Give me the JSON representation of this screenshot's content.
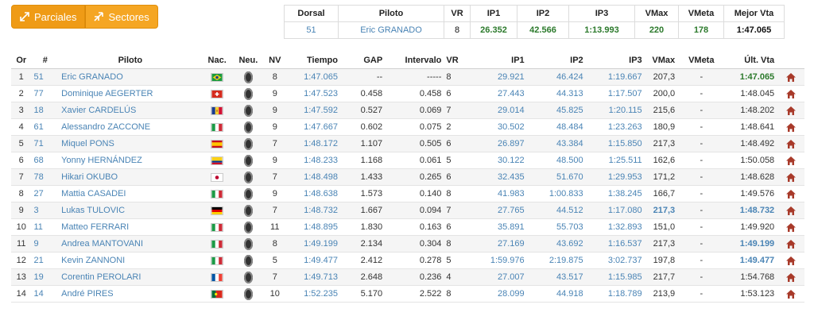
{
  "tabs": [
    {
      "label": "Parciales",
      "icon": "expand-arrows-icon"
    },
    {
      "label": "Sectores",
      "icon": "shrink-arrows-icon"
    }
  ],
  "best": {
    "headers": [
      "Dorsal",
      "Piloto",
      "VR",
      "IP1",
      "IP2",
      "IP3",
      "VMax",
      "VMeta",
      "Mejor Vta"
    ],
    "row": {
      "dorsal": "51",
      "piloto": "Eric GRANADO",
      "vr": "8",
      "ip1": "26.352",
      "ip2": "42.566",
      "ip3": "1:13.993",
      "vmax": "220",
      "vmeta": "178",
      "mejor": "1:47.065"
    }
  },
  "main": {
    "headers": [
      "Or",
      "#",
      "Piloto",
      "Nac.",
      "Neu.",
      "NV",
      "Tiempo",
      "GAP",
      "Intervalo",
      "VR",
      "IP1",
      "IP2",
      "IP3",
      "VMax",
      "VMeta",
      "Últ. Vta"
    ],
    "rows": [
      {
        "or": "1",
        "num": "51",
        "piloto": "Eric GRANADO",
        "flag": "brazil",
        "nv": "8",
        "tiempo": "1:47.065",
        "gap": "--",
        "intervalo": "-----",
        "vr": "8",
        "ip1": "29.921",
        "ip2": "46.424",
        "ip3": "1:19.667",
        "vmax": "207,3",
        "vmeta": "-",
        "ult": "1:47.065",
        "ult_hl": true
      },
      {
        "or": "2",
        "num": "77",
        "piloto": "Dominique AEGERTER",
        "flag": "switzerland",
        "nv": "9",
        "tiempo": "1:47.523",
        "gap": "0.458",
        "intervalo": "0.458",
        "vr": "6",
        "ip1": "27.443",
        "ip2": "44.313",
        "ip3": "1:17.507",
        "vmax": "200,0",
        "vmeta": "-",
        "ult": "1:48.045",
        "ult_hl": false
      },
      {
        "or": "3",
        "num": "18",
        "piloto": "Xavier CARDELÚS",
        "flag": "andorra",
        "nv": "9",
        "tiempo": "1:47.592",
        "gap": "0.527",
        "intervalo": "0.069",
        "vr": "7",
        "ip1": "29.014",
        "ip2": "45.825",
        "ip3": "1:20.115",
        "vmax": "215,6",
        "vmeta": "-",
        "ult": "1:48.202",
        "ult_hl": false
      },
      {
        "or": "4",
        "num": "61",
        "piloto": "Alessandro ZACCONE",
        "flag": "italy",
        "nv": "9",
        "tiempo": "1:47.667",
        "gap": "0.602",
        "intervalo": "0.075",
        "vr": "2",
        "ip1": "30.502",
        "ip2": "48.484",
        "ip3": "1:23.263",
        "vmax": "180,9",
        "vmeta": "-",
        "ult": "1:48.641",
        "ult_hl": false
      },
      {
        "or": "5",
        "num": "71",
        "piloto": "Miquel PONS",
        "flag": "spain",
        "nv": "7",
        "tiempo": "1:48.172",
        "gap": "1.107",
        "intervalo": "0.505",
        "vr": "6",
        "ip1": "26.897",
        "ip2": "43.384",
        "ip3": "1:15.850",
        "vmax": "217,3",
        "vmeta": "-",
        "ult": "1:48.492",
        "ult_hl": false
      },
      {
        "or": "6",
        "num": "68",
        "piloto": "Yonny HERNÁNDEZ",
        "flag": "colombia",
        "nv": "9",
        "tiempo": "1:48.233",
        "gap": "1.168",
        "intervalo": "0.061",
        "vr": "5",
        "ip1": "30.122",
        "ip2": "48.500",
        "ip3": "1:25.511",
        "vmax": "162,6",
        "vmeta": "-",
        "ult": "1:50.058",
        "ult_hl": false
      },
      {
        "or": "7",
        "num": "78",
        "piloto": "Hikari OKUBO",
        "flag": "japan",
        "nv": "7",
        "tiempo": "1:48.498",
        "gap": "1.433",
        "intervalo": "0.265",
        "vr": "6",
        "ip1": "32.435",
        "ip2": "51.670",
        "ip3": "1:29.953",
        "vmax": "171,2",
        "vmeta": "-",
        "ult": "1:48.628",
        "ult_hl": false
      },
      {
        "or": "8",
        "num": "27",
        "piloto": "Mattia CASADEI",
        "flag": "italy",
        "nv": "9",
        "tiempo": "1:48.638",
        "gap": "1.573",
        "intervalo": "0.140",
        "vr": "8",
        "ip1": "41.983",
        "ip2": "1:00.833",
        "ip3": "1:38.245",
        "vmax": "166,7",
        "vmeta": "-",
        "ult": "1:49.576",
        "ult_hl": false
      },
      {
        "or": "9",
        "num": "3",
        "piloto": "Lukas TULOVIC",
        "flag": "germany",
        "nv": "7",
        "tiempo": "1:48.732",
        "gap": "1.667",
        "intervalo": "0.094",
        "vr": "7",
        "ip1": "27.765",
        "ip2": "44.512",
        "ip3": "1:17.080",
        "vmax": "217,3",
        "vmeta": "-",
        "ult": "1:48.732",
        "ult_hl": true,
        "vmax_hl": true
      },
      {
        "or": "10",
        "num": "11",
        "piloto": "Matteo FERRARI",
        "flag": "italy",
        "nv": "11",
        "tiempo": "1:48.895",
        "gap": "1.830",
        "intervalo": "0.163",
        "vr": "6",
        "ip1": "35.891",
        "ip2": "55.703",
        "ip3": "1:32.893",
        "vmax": "151,0",
        "vmeta": "-",
        "ult": "1:49.920",
        "ult_hl": false
      },
      {
        "or": "11",
        "num": "9",
        "piloto": "Andrea MANTOVANI",
        "flag": "italy",
        "nv": "8",
        "tiempo": "1:49.199",
        "gap": "2.134",
        "intervalo": "0.304",
        "vr": "8",
        "ip1": "27.169",
        "ip2": "43.692",
        "ip3": "1:16.537",
        "vmax": "217,3",
        "vmeta": "-",
        "ult": "1:49.199",
        "ult_hl": true
      },
      {
        "or": "12",
        "num": "21",
        "piloto": "Kevin ZANNONI",
        "flag": "italy",
        "nv": "5",
        "tiempo": "1:49.477",
        "gap": "2.412",
        "intervalo": "0.278",
        "vr": "5",
        "ip1": "1:59.976",
        "ip2": "2:19.875",
        "ip3": "3:02.737",
        "vmax": "197,8",
        "vmeta": "-",
        "ult": "1:49.477",
        "ult_hl": true
      },
      {
        "or": "13",
        "num": "19",
        "piloto": "Corentin PEROLARI",
        "flag": "france",
        "nv": "7",
        "tiempo": "1:49.713",
        "gap": "2.648",
        "intervalo": "0.236",
        "vr": "4",
        "ip1": "27.007",
        "ip2": "43.517",
        "ip3": "1:15.985",
        "vmax": "217,7",
        "vmeta": "-",
        "ult": "1:54.768",
        "ult_hl": false
      },
      {
        "or": "14",
        "num": "14",
        "piloto": "André PIRES",
        "flag": "portugal",
        "nv": "10",
        "tiempo": "1:52.235",
        "gap": "5.170",
        "intervalo": "2.522",
        "vr": "8",
        "ip1": "28.099",
        "ip2": "44.918",
        "ip3": "1:18.789",
        "vmax": "213,9",
        "vmeta": "-",
        "ult": "1:53.123",
        "ult_hl": false
      }
    ]
  },
  "colors": {
    "accent": "#f5a623",
    "link": "#4a84b5",
    "best": "#2c7a2c",
    "home_icon": "#a83a2a"
  }
}
